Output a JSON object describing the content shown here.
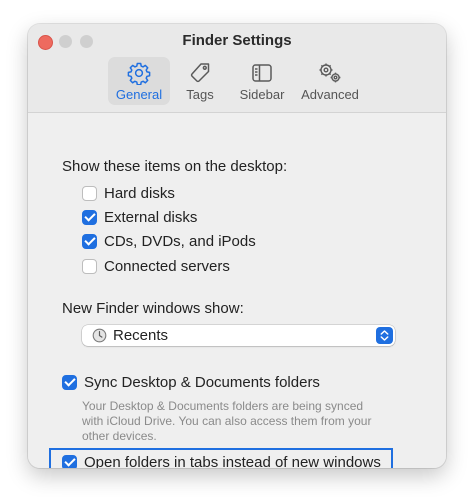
{
  "window": {
    "title": "Finder Settings"
  },
  "tabs": [
    {
      "label": "General",
      "icon": "gear-icon",
      "active": true
    },
    {
      "label": "Tags",
      "icon": "tag-icon",
      "active": false
    },
    {
      "label": "Sidebar",
      "icon": "sidebar-icon",
      "active": false
    },
    {
      "label": "Advanced",
      "icon": "gears-icon",
      "active": false
    }
  ],
  "desktop_section": {
    "heading": "Show these items on the desktop:",
    "items": [
      {
        "label": "Hard disks",
        "checked": false
      },
      {
        "label": "External disks",
        "checked": true
      },
      {
        "label": "CDs, DVDs, and iPods",
        "checked": true
      },
      {
        "label": "Connected servers",
        "checked": false
      }
    ]
  },
  "new_window_section": {
    "heading": "New Finder windows show:",
    "selected": "Recents",
    "icon": "clock-icon"
  },
  "sync": {
    "label": "Sync Desktop & Documents folders",
    "checked": true,
    "help": "Your Desktop & Documents folders are being synced with iCloud Drive. You can also access them from your other devices."
  },
  "tabs_option": {
    "label": "Open folders in tabs instead of new windows",
    "checked": true,
    "highlighted": true
  },
  "colors": {
    "accent": "#1f6fe0",
    "highlight_border": "#1f6fe0",
    "close_button": "#ee6a5f"
  }
}
